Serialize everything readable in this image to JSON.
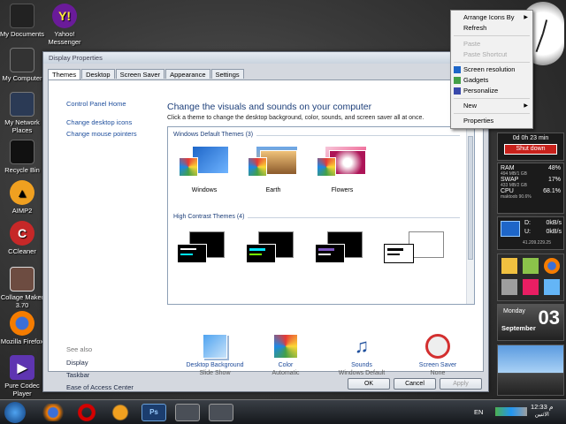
{
  "desktop": {
    "icons": [
      {
        "label": "My Documents",
        "icon": "folder-icon"
      },
      {
        "label": "Yahoo! Messenger",
        "icon": "yahoo-icon"
      },
      {
        "label": "My Computer",
        "icon": "computer-icon"
      },
      {
        "label": "My Network Places",
        "icon": "network-icon"
      },
      {
        "label": "Recycle Bin",
        "icon": "recycle-bin-icon"
      },
      {
        "label": "AIMP2",
        "icon": "aimp-icon"
      },
      {
        "label": "CCleaner",
        "icon": "ccleaner-icon"
      },
      {
        "label": "Collage Maker 3.70",
        "icon": "collage-icon"
      },
      {
        "label": "Mozilla Firefox",
        "icon": "firefox-icon"
      },
      {
        "label": "Pure Codec Player",
        "icon": "codec-player-icon"
      }
    ]
  },
  "dialog": {
    "title": "Display Properties",
    "tabs": [
      "Themes",
      "Desktop",
      "Screen Saver",
      "Appearance",
      "Settings"
    ],
    "left_links": [
      "Control Panel Home",
      "Change desktop icons",
      "Change mouse pointers"
    ],
    "see_also": {
      "heading": "See also",
      "items": [
        "Display",
        "Taskbar",
        "Ease of Access Center"
      ]
    },
    "heading": "Change the visuals and sounds on your computer",
    "subheading": "Click a theme to change the desktop background, color, sounds, and screen saver all at once.",
    "groups": {
      "default": "Windows Default Themes (3)",
      "contrast": "High Contrast Themes (4)"
    },
    "themes": [
      "Windows",
      "Earth",
      "Flowers"
    ],
    "settings": [
      {
        "label": "Desktop Background",
        "value": "Slide Show",
        "icon": "desktop-background-icon"
      },
      {
        "label": "Color",
        "value": "Automatic",
        "icon": "color-icon"
      },
      {
        "label": "Sounds",
        "value": "Windows Default",
        "icon": "sounds-icon"
      },
      {
        "label": "Screen Saver",
        "value": "None",
        "icon": "screen-saver-icon"
      }
    ],
    "buttons": {
      "ok": "OK",
      "cancel": "Cancel",
      "apply": "Apply"
    }
  },
  "context_menu": {
    "arrange": "Arrange Icons By",
    "refresh": "Refresh",
    "paste": "Paste",
    "paste_shortcut": "Paste Shortcut",
    "screen_resolution": "Screen resolution",
    "gadgets": "Gadgets",
    "personalize": "Personalize",
    "new": "New",
    "properties": "Properties"
  },
  "gadgets": {
    "timer": "0d 0h 23 min",
    "shutdown": "Shut down",
    "ram_label": "RAM",
    "ram_pct": "48%",
    "ram_detail": "494 MB/1 GB",
    "swap_label": "SWAP",
    "swap_pct": "17%",
    "swap_detail": "433 MB/2 GB",
    "cpu_label": "CPU",
    "cpu_pct": "68.1%",
    "cpu_detail": "maktoob 90.6%",
    "net_d": "D:",
    "net_d_val": "0kB/s",
    "net_u": "U:",
    "net_u_val": "0kB/s",
    "ip": "41.209.229.25",
    "day": "Monday",
    "date": "03",
    "month": "September"
  },
  "taskbar": {
    "lang": "EN",
    "time": "12:33",
    "ampm": "م",
    "day_ar": "الاثنين"
  },
  "colors": {
    "link": "#1e4e9c",
    "heading": "#1d3f7a",
    "shutdown": "#c8211b"
  }
}
